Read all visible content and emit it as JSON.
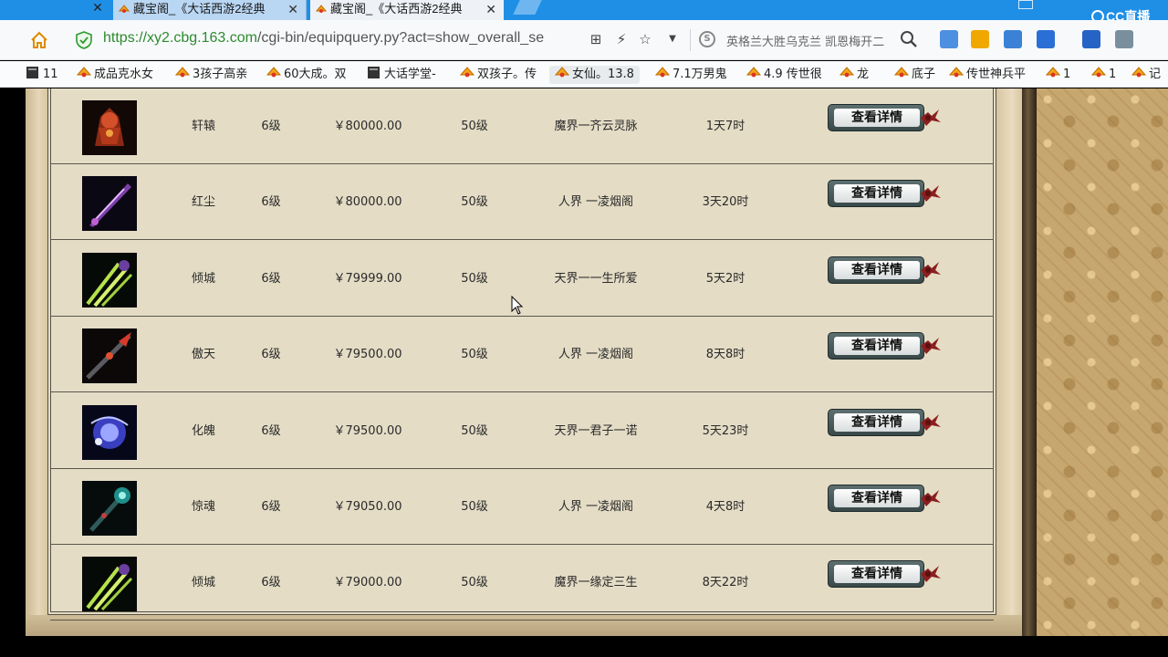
{
  "browser": {
    "tabs": [
      {
        "title": "藏宝阁_《大话西游2经典"
      },
      {
        "title": "藏宝阁_《大话西游2经典"
      }
    ],
    "brand": "CC直播",
    "url_host": "https://xy2.cbg.163.com",
    "url_path": "/cgi-bin/equipquery.py?act=show_overall_se",
    "search_text": "英格兰大胜乌克兰 凯恩梅开二"
  },
  "bookmarks": [
    {
      "label": "11"
    },
    {
      "label": "成品克水女"
    },
    {
      "label": "3孩子高亲"
    },
    {
      "label": "60大成。双"
    },
    {
      "label": "大话学堂-"
    },
    {
      "label": "双孩子。传"
    },
    {
      "label": "女仙。13.8"
    },
    {
      "label": "7.1万男鬼"
    },
    {
      "label": "4.9 传世很"
    },
    {
      "label": "龙"
    },
    {
      "label": "底子"
    },
    {
      "label": "传世神兵平"
    },
    {
      "label": "1"
    },
    {
      "label": "1"
    },
    {
      "label": "记"
    }
  ],
  "table": {
    "button_label": "查看详情",
    "rows": [
      {
        "name": "轩辕",
        "level": "6级",
        "price": "￥80000.00",
        "req": "50级",
        "server": "魔界一齐云灵脉",
        "time": "1天7时",
        "thumb": "red-armor"
      },
      {
        "name": "红尘",
        "level": "6级",
        "price": "￥80000.00",
        "req": "50级",
        "server": "人界 一凌烟阁",
        "time": "3天20时",
        "thumb": "purple-blade"
      },
      {
        "name": "倾城",
        "level": "6级",
        "price": "￥79999.00",
        "req": "50级",
        "server": "天界一一生所爱",
        "time": "5天2时",
        "thumb": "green-claw"
      },
      {
        "name": "傲天",
        "level": "6级",
        "price": "￥79500.00",
        "req": "50级",
        "server": "人界 一凌烟阁",
        "time": "8天8时",
        "thumb": "red-spear"
      },
      {
        "name": "化魄",
        "level": "6级",
        "price": "￥79500.00",
        "req": "50级",
        "server": "天界一君子一诺",
        "time": "5天23时",
        "thumb": "blue-orb"
      },
      {
        "name": "惊魂",
        "level": "6级",
        "price": "￥79050.00",
        "req": "50级",
        "server": "人界 一凌烟阁",
        "time": "4天8时",
        "thumb": "teal-staff"
      },
      {
        "name": "倾城",
        "level": "6级",
        "price": "￥79000.00",
        "req": "50级",
        "server": "魔界一缘定三生",
        "time": "8天22时",
        "thumb": "green-claw"
      }
    ]
  },
  "colors": {
    "tabbar": "#1f8fe6",
    "panel": "#e4dcc5",
    "row_border": "#5a574a",
    "button_frame": "#39494a",
    "ribbon": "#8c1f1f"
  }
}
